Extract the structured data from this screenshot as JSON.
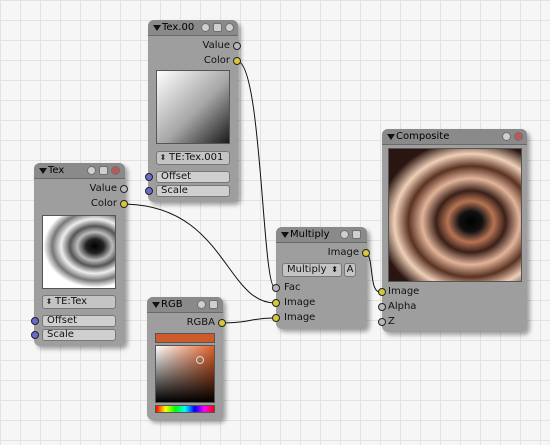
{
  "nodes": {
    "tex00": {
      "title": "Tex.00",
      "outputs": {
        "value": "Value",
        "color": "Color"
      },
      "texture_browse": "TE:Tex.001",
      "inputs": {
        "offset": "Offset",
        "scale": "Scale"
      }
    },
    "tex": {
      "title": "Tex",
      "outputs": {
        "value": "Value",
        "color": "Color"
      },
      "texture_browse": "TE:Tex",
      "inputs": {
        "offset": "Offset",
        "scale": "Scale"
      }
    },
    "rgb": {
      "title": "RGB",
      "outputs": {
        "rgba": "RGBA"
      },
      "swatch_color": "#cc5a2a"
    },
    "multiply": {
      "title": "Multiply",
      "outputs": {
        "image": "Image"
      },
      "blend_mode": "Multiply",
      "alpha_toggle": "A",
      "inputs": {
        "fac": "Fac",
        "image1": "Image",
        "image2": "Image"
      }
    },
    "composite": {
      "title": "Composite",
      "inputs": {
        "image": "Image",
        "alpha": "Alpha",
        "z": "Z"
      }
    }
  },
  "colors": {
    "socket_color": "#d6c83a",
    "socket_value": "#b8b8b8",
    "socket_vector": "#6a6ad0",
    "node_body": "#9e9e9e",
    "node_header": "#8a8a8a"
  },
  "icons": [
    "collapse-arrow-icon",
    "preview-toggle-icon",
    "options-icon",
    "close-node-icon",
    "browse-arrows-icon"
  ]
}
